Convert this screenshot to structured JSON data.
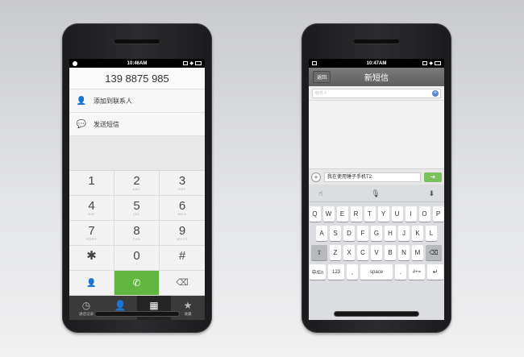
{
  "left_phone": {
    "status": {
      "time": "10:46AM"
    },
    "dialer": {
      "number": "139 8875 985",
      "actions": [
        {
          "label": "添加到联系人",
          "icon": "add-contact-icon"
        },
        {
          "label": "发送短信",
          "icon": "message-icon"
        }
      ],
      "keys": [
        {
          "digit": "1",
          "letters": ""
        },
        {
          "digit": "2",
          "letters": "ABC"
        },
        {
          "digit": "3",
          "letters": "DEF"
        },
        {
          "digit": "4",
          "letters": "GHI"
        },
        {
          "digit": "5",
          "letters": "JKL"
        },
        {
          "digit": "6",
          "letters": "MNO"
        },
        {
          "digit": "7",
          "letters": "PQRS"
        },
        {
          "digit": "8",
          "letters": "TUV"
        },
        {
          "digit": "9",
          "letters": "WXYZ"
        },
        {
          "digit": "✱",
          "letters": ""
        },
        {
          "digit": "0",
          "letters": "+"
        },
        {
          "digit": "#",
          "letters": ""
        }
      ],
      "bottom_row": {
        "add_contact": "👤",
        "call": "✆",
        "delete": "⌫"
      }
    },
    "nav": [
      {
        "label": "通话记录",
        "icon": "◷"
      },
      {
        "label": "联系人",
        "icon": "👤"
      },
      {
        "label": "拨号",
        "icon": "▦"
      },
      {
        "label": "收藏",
        "icon": "★"
      }
    ]
  },
  "right_phone": {
    "status": {
      "time": "10:47AM"
    },
    "sms": {
      "back": "返回",
      "title": "新短信",
      "recipient_placeholder": "收件人",
      "compose_text": "我在使用锤子手机T2.",
      "send_icon": "➜"
    },
    "keyboard": {
      "tool_left": "☝",
      "tool_mid": "🎙",
      "tool_right": "⬇",
      "row1": [
        "Q",
        "W",
        "E",
        "R",
        "T",
        "Y",
        "U",
        "I",
        "O",
        "P"
      ],
      "row2": [
        "A",
        "S",
        "D",
        "F",
        "G",
        "H",
        "J",
        "K",
        "L"
      ],
      "row3": [
        "Z",
        "X",
        "C",
        "V",
        "B",
        "N",
        "M"
      ],
      "shift": "⇧",
      "del": "⌫",
      "lang": "中/En",
      "num": "123",
      "comma": ",",
      "space": "space",
      "period": ".",
      "sym": "#+=",
      "enter": "↵"
    }
  }
}
